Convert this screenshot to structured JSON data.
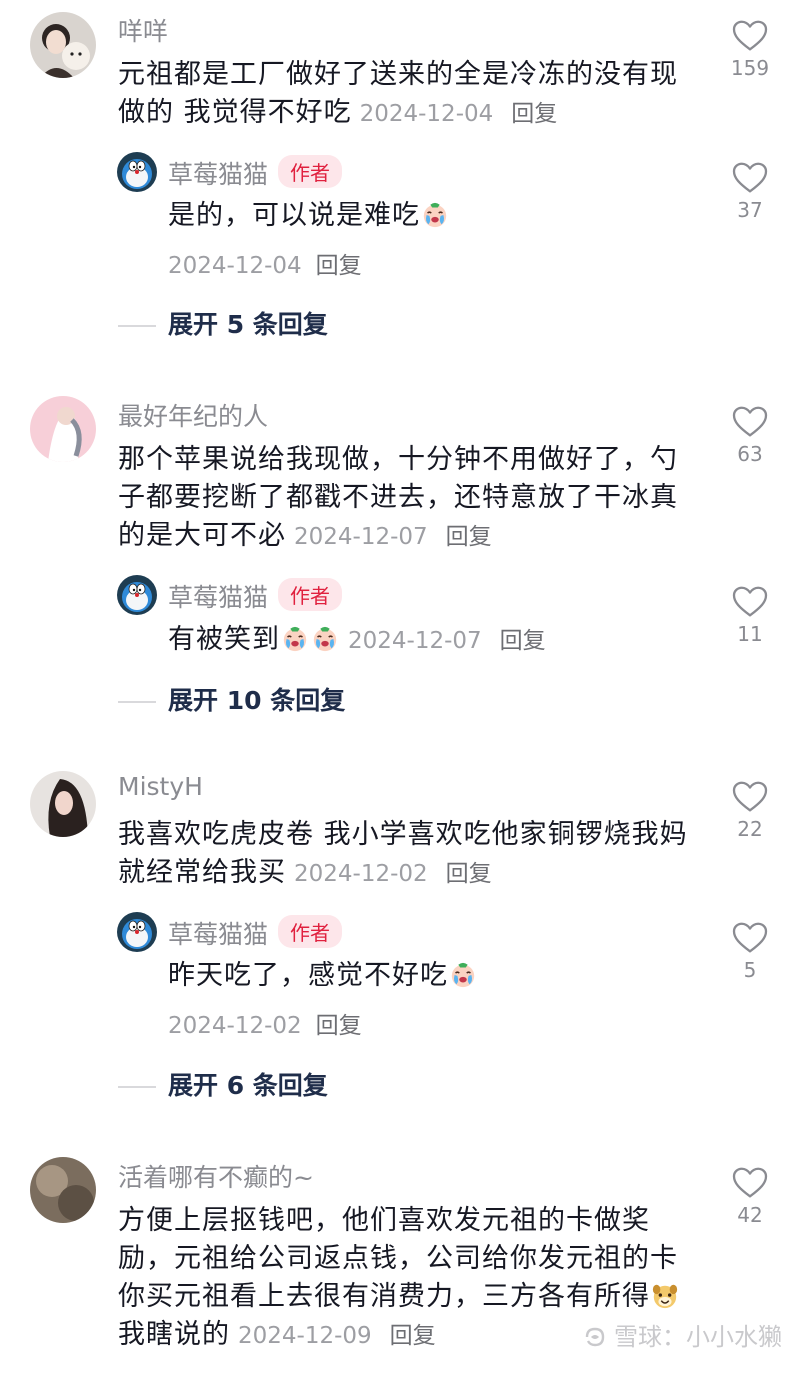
{
  "comments": [
    {
      "username": "咩咩",
      "text": "元祖都是工厂做好了送来的全是冷冻的没有现做的 我觉得不好吃",
      "date": "2024-12-04",
      "reply_label": "回复",
      "likes": "159",
      "avatar_icon": "girl-with-plush-avatar",
      "reply": {
        "username": "草莓猫猫",
        "badge": "作者",
        "text": "是的，可以说是难吃",
        "emoji": "crying-face-emoji",
        "date": "2024-12-04",
        "reply_label": "回复",
        "likes": "37"
      },
      "expand": "展开 5 条回复"
    },
    {
      "username": "最好年纪的人",
      "text": "那个苹果说给我现做，十分钟不用做好了，勺子都要挖断了都戳不进去，还特意放了干冰真的是大可不必",
      "date": "2024-12-07",
      "reply_label": "回复",
      "likes": "63",
      "avatar_icon": "pink-figure-avatar",
      "reply": {
        "username": "草莓猫猫",
        "badge": "作者",
        "text": "有被笑到",
        "emoji": "crying-face-emoji",
        "date": "2024-12-07",
        "reply_label": "回复",
        "likes": "11"
      },
      "expand": "展开 10 条回复"
    },
    {
      "username": "MistyH",
      "text": "我喜欢吃虎皮卷 我小学喜欢吃他家铜锣烧我妈就经常给我买",
      "date": "2024-12-02",
      "reply_label": "回复",
      "likes": "22",
      "avatar_icon": "portrait-avatar",
      "reply": {
        "username": "草莓猫猫",
        "badge": "作者",
        "text": "昨天吃了，感觉不好吃",
        "emoji": "crying-face-emoji",
        "date": "2024-12-02",
        "reply_label": "回复",
        "likes": "5"
      },
      "expand": "展开 6 条回复"
    },
    {
      "username": "活着哪有不癫的~",
      "text": "方便上层抠钱吧，他们喜欢发元祖的卡做奖励，元祖给公司返点钱，公司给你发元祖的卡你买元祖看上去很有消费力，三方各有所得",
      "text_tail": "我瞎说的",
      "emoji": "grinning-dog-emoji",
      "date": "2024-12-09",
      "reply_label": "回复",
      "likes": "42",
      "avatar_icon": "blurred-photo-avatar"
    }
  ],
  "watermark": "雪球：小小水獭",
  "colors": {
    "badge_bg": "#fde6ea",
    "badge_text": "#e0213f",
    "username": "#8a8b91",
    "expand": "#1f2d4a"
  }
}
